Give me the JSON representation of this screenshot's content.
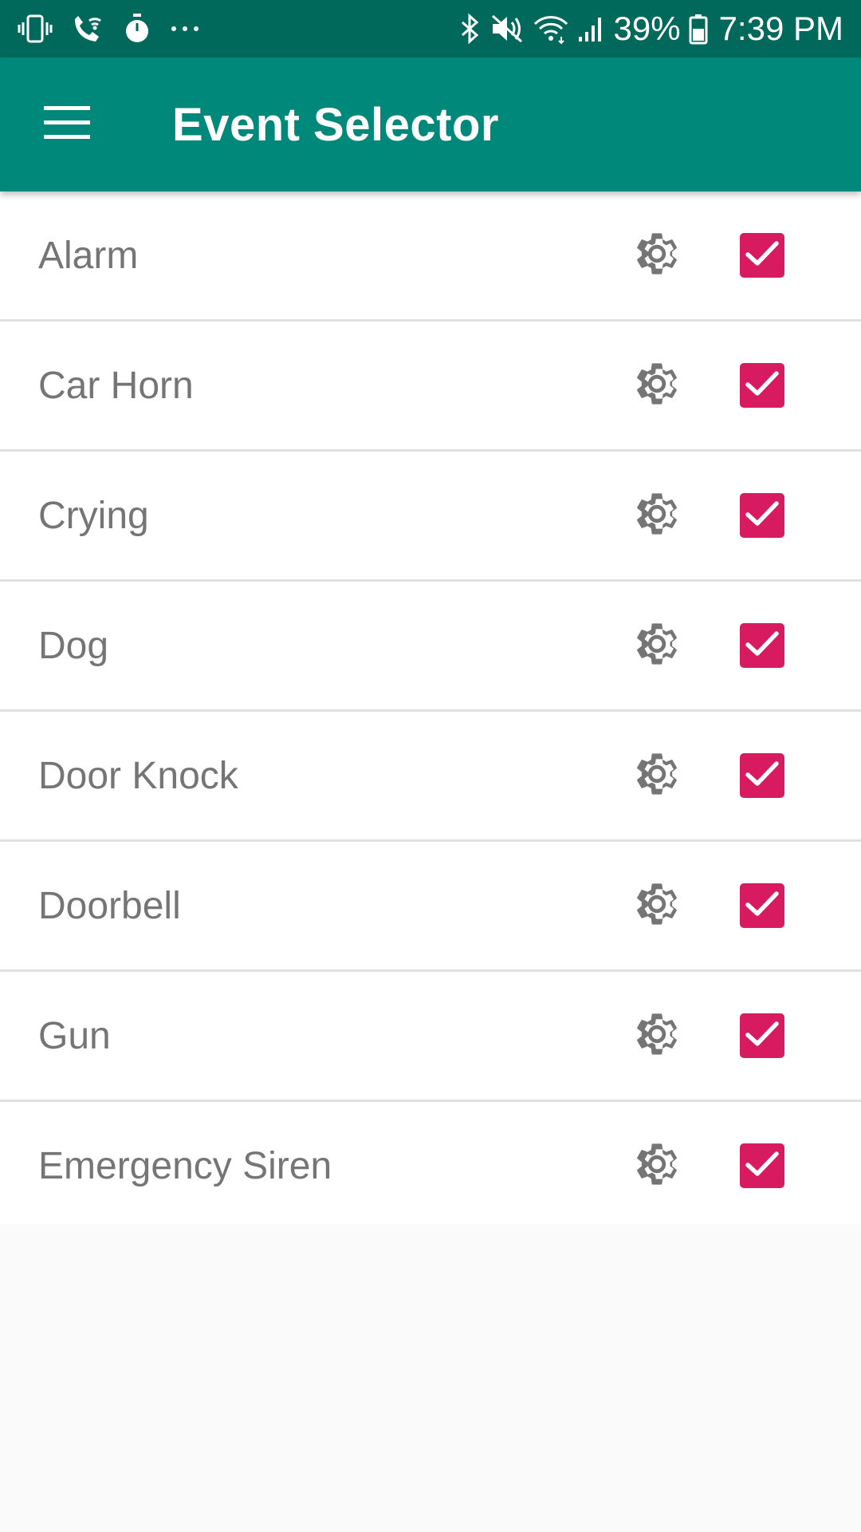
{
  "status_bar": {
    "battery": "39%",
    "time": "7:39 PM",
    "icons_left": [
      "vibrate-icon",
      "wifi-calling-icon",
      "stopwatch-icon",
      "more-dots-icon"
    ],
    "icons_right": [
      "bluetooth-icon",
      "mute-icon",
      "wifi-icon",
      "signal-icon",
      "battery-icon"
    ]
  },
  "app_bar": {
    "title": "Event Selector",
    "menu_icon": "hamburger-menu-icon",
    "background": "#00897b"
  },
  "events": [
    {
      "label": "Alarm",
      "checked": true
    },
    {
      "label": "Car Horn",
      "checked": true
    },
    {
      "label": "Crying",
      "checked": true
    },
    {
      "label": "Dog",
      "checked": true
    },
    {
      "label": "Door Knock",
      "checked": true
    },
    {
      "label": "Doorbell",
      "checked": true
    },
    {
      "label": "Gun",
      "checked": true
    },
    {
      "label": "Emergency Siren",
      "checked": true
    }
  ],
  "colors": {
    "status_bar": "#00695c",
    "app_bar": "#00897b",
    "checkbox": "#d81b60",
    "label_text": "#757575",
    "gear_icon": "#757575"
  }
}
